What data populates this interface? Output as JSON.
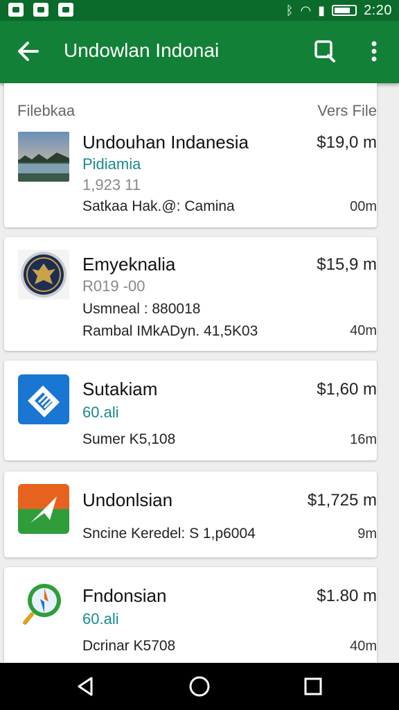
{
  "status_bar": {
    "time": "2:20"
  },
  "app_bar": {
    "title": "Undowlan Indonai"
  },
  "list_header": {
    "left": "Filebkaa",
    "right": "Vers File"
  },
  "items": [
    {
      "name": "Undouhan Indanesia",
      "line1": "Pidiamia",
      "line2": "1,923 11",
      "line3": "Satkaa Hak.@: Camina",
      "price": "$19,0 m",
      "size": "00m",
      "thumb": "landscape-photo"
    },
    {
      "name": "Emyeknalia",
      "line1": "R019 -00",
      "line2": "Usmneal : 880018",
      "line3": "Rambal IMkADyn. 41,5K03",
      "price": "$15,9 m",
      "size": "40m",
      "thumb": "emblem-seal"
    },
    {
      "name": "Sutakiam",
      "line1": "60.ali",
      "line3": "Sumer K5,108",
      "price": "$1,60 m",
      "size": "16m",
      "thumb": "blue-app-icon"
    },
    {
      "name": "Undonlsian",
      "line3": "Sncine Keredel: S 1,p6004",
      "price": "$1,725 m",
      "size": "9m",
      "thumb": "plane-app-icon"
    },
    {
      "name": "Fndonsian",
      "line1": "60.ali",
      "line3": "Dcrinar K5708",
      "price": "$1.80 m",
      "size": "40m",
      "thumb": "compass-app-icon"
    }
  ],
  "colors": {
    "primary": "#128036",
    "status": "#0a6b2a",
    "teal_text": "#1a8a8a"
  }
}
